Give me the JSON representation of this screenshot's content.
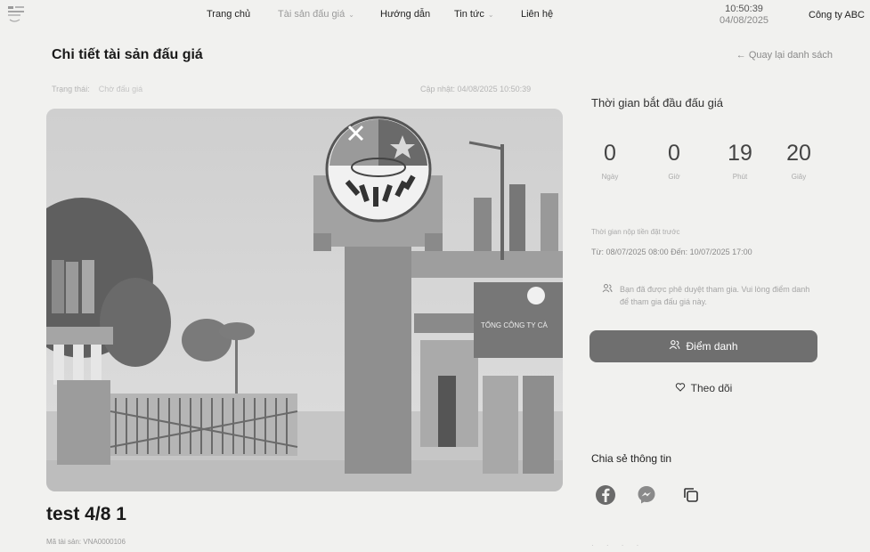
{
  "header": {
    "nav": [
      {
        "label": "Trang chủ",
        "dropdown": false
      },
      {
        "label": "Tài sản đấu giá",
        "dropdown": true
      },
      {
        "label": "Hướng dẫn",
        "dropdown": false
      },
      {
        "label": "Tin tức",
        "dropdown": true
      },
      {
        "label": "Liên hệ",
        "dropdown": false
      }
    ],
    "time": "10:50:39",
    "date": "04/08/2025",
    "company": "Công ty ABC",
    "logo_icon": "company-logo"
  },
  "page": {
    "title": "Chi tiết tài sản đấu giá",
    "back_link": "← Quay lại danh sách"
  },
  "status": {
    "label": "Trạng thái:",
    "value": "Chờ đấu giá",
    "updated": "Cập nhật: 04/08/2025 10:50:39"
  },
  "asset": {
    "title": "test 4/8 1",
    "code": "Mã tài sản: VNA0000106",
    "sign_text": "TỔNG CÔNG TY CÀ"
  },
  "auction": {
    "countdown_title": "Thời gian bắt đầu đấu giá",
    "countdown": [
      {
        "value": "0",
        "label": "Ngày"
      },
      {
        "value": "0",
        "label": "Giờ"
      },
      {
        "value": "19",
        "label": "Phút"
      },
      {
        "value": "20",
        "label": "Giây"
      }
    ],
    "deposit_label": "Thời gian nộp tiền đặt trước",
    "deposit_range": "Từ: 08/07/2025 08:00 Đến: 10/07/2025 17:00",
    "notice": "Bạn đã được phê duyệt tham gia. Vui lòng điểm danh để tham gia đấu giá này.",
    "checkin_label": "Điểm danh",
    "follow_label": "Theo dõi"
  },
  "share": {
    "title": "Chia sẻ thông tin",
    "icons": [
      "facebook-icon",
      "messenger-icon",
      "copy-icon"
    ]
  },
  "colors": {
    "background": "#f1f1ef",
    "button": "#6f6f6f",
    "text": "#222222"
  }
}
